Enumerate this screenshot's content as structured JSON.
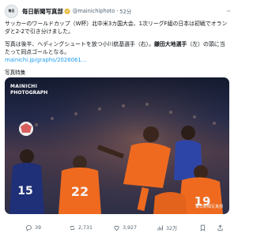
{
  "account": {
    "name": "毎日新聞写真部",
    "handle": "@mainichiphoto",
    "separator": "·",
    "time": "52分",
    "avatar_text": "毎日",
    "more": "···"
  },
  "post": {
    "line1": "サッカーのワールドカップ（W杯）北中米3カ国大会、1次リーグF組の日本は初戦でオランダと2-2で引き分けました。",
    "line2_plain": "写真は後半、ヘディングシュートを放つ小川航基選手（右）。",
    "line2_bold": "鎌田大地選手",
    "line2_rest": "（左）の頭に当たって同点ゴールとなる。",
    "link": "mainichi.jp/graphs/2026061...",
    "credit": "写真特集"
  },
  "photo": {
    "watermark_line1": "MAINICHI",
    "watermark_line2": "PHOTOGRAPH",
    "corner_credit": "毎日新聞写真部",
    "jerseys": {
      "left": "15",
      "mid": "22",
      "right": "19"
    },
    "colors": {
      "orange": "#ef6a1f",
      "navy": "#1f2f78",
      "white": "#f4f4f4"
    }
  },
  "actions": {
    "reply": "39",
    "repost": "2,731",
    "like": "3,927",
    "views": "32万"
  },
  "icons": [
    "verified-icon",
    "more-icon",
    "reply-icon",
    "repost-icon",
    "like-icon",
    "views-icon",
    "bookmark-icon",
    "share-icon"
  ]
}
